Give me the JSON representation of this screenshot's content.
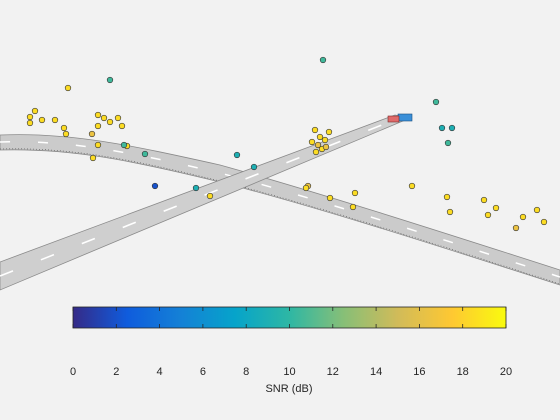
{
  "colorbar": {
    "label": "SNR (dB)",
    "min": 0,
    "max": 20,
    "ticks": [
      "0",
      "2",
      "4",
      "6",
      "8",
      "10",
      "12",
      "14",
      "16",
      "18",
      "20"
    ],
    "colormap": "parula",
    "stops": [
      "#352a87",
      "#0f5cdd",
      "#1481d6",
      "#06a4ca",
      "#2eb7a4",
      "#87bf77",
      "#d1bb59",
      "#fec832",
      "#f9fb0e"
    ]
  },
  "detections_snr": {
    "yellow_cluster": 18.5,
    "green_cluster": 10.5,
    "orange_mid": 16.5,
    "cyan_points": 9
  },
  "colors": {
    "background": "#f2f2f2",
    "road": "#c8c8c8",
    "road_edge": "#8a8a8a",
    "lane_marking": "#ffffff",
    "ego_vehicle": "#3a8fd8",
    "target_vehicle": "#e06a6a"
  }
}
